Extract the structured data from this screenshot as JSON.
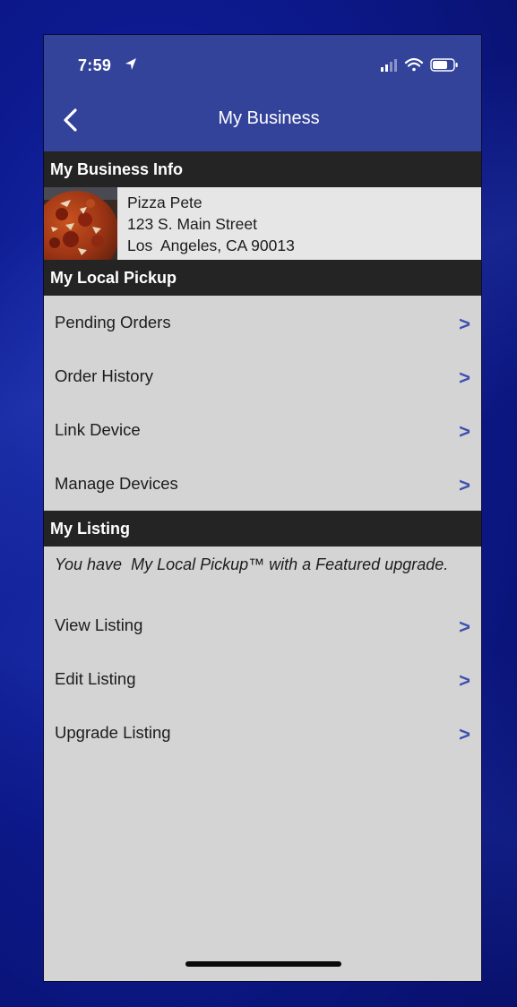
{
  "status_bar": {
    "time": "7:59"
  },
  "nav": {
    "title": "My Business"
  },
  "sections": {
    "business_info": "My Business Info",
    "local_pickup": "My Local Pickup",
    "listing": "My Listing"
  },
  "business": {
    "name": "Pizza Pete",
    "street": "123 S. Main Street",
    "city": "Los  Angeles, CA 90013"
  },
  "pickup_items": [
    {
      "label": "Pending Orders",
      "chevron": ">"
    },
    {
      "label": "Order History",
      "chevron": ">"
    },
    {
      "label": "Link Device",
      "chevron": ">"
    },
    {
      "label": "Manage Devices",
      "chevron": ">"
    }
  ],
  "listing_note": "You have  My Local Pickup™ with a Featured upgrade.",
  "listing_items": [
    {
      "label": "View Listing",
      "chevron": ">"
    },
    {
      "label": "Edit Listing",
      "chevron": ">"
    },
    {
      "label": "Upgrade Listing",
      "chevron": ">"
    }
  ],
  "colors": {
    "header_bg": "#33439a",
    "section_bg": "#242424",
    "content_bg": "#d4d4d4",
    "chevron": "#3d4fb0"
  }
}
